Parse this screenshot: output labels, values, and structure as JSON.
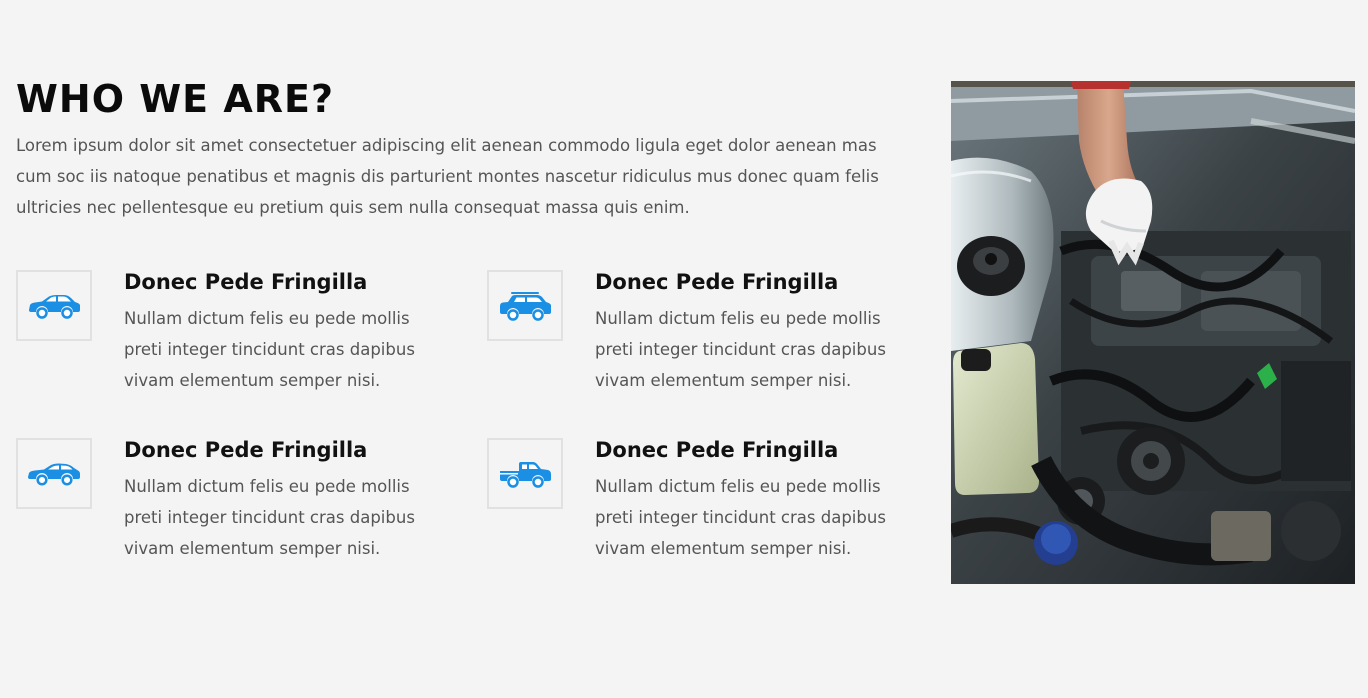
{
  "about": {
    "title": "WHO WE ARE?",
    "intro": "Lorem ipsum dolor sit amet consectetuer adipiscing elit aenean commodo ligula eget dolor aenean mas cum soc iis natoque penatibus et magnis dis parturient montes nascetur ridiculus mus donec quam felis ultricies nec pellentesque eu pretium quis sem nulla consequat massa quis enim.",
    "features": [
      {
        "icon": "sedan-car-icon",
        "title": "Donec Pede Fringilla",
        "text": "Nullam dictum felis eu pede mollis preti integer tincidunt cras dapibus vivam elementum semper nisi."
      },
      {
        "icon": "suv-car-icon",
        "title": "Donec Pede Fringilla",
        "text": "Nullam dictum felis eu pede mollis preti integer tincidunt cras dapibus vivam elementum semper nisi."
      },
      {
        "icon": "sports-car-icon",
        "title": "Donec Pede Fringilla",
        "text": "Nullam dictum felis eu pede mollis preti integer tincidunt cras dapibus vivam elementum semper nisi."
      },
      {
        "icon": "pickup-truck-icon",
        "title": "Donec Pede Fringilla",
        "text": "Nullam dictum felis eu pede mollis preti integer tincidunt cras dapibus vivam elementum semper nisi."
      }
    ],
    "photo": {
      "subject": "mechanic-hand-in-car-engine-photo"
    }
  },
  "colors": {
    "accent": "#1a8fe3",
    "background": "#f4f4f4",
    "heading": "#0b0b0b",
    "body_text": "#555555",
    "icon_border": "#e1e1e1"
  }
}
